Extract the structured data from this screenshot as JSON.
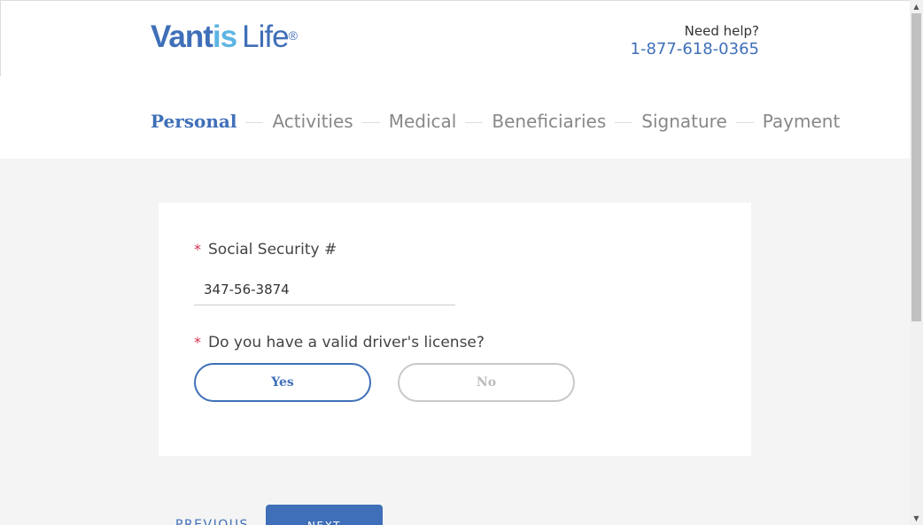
{
  "brand": {
    "logo_part1": "Vant",
    "logo_part2": "is",
    "logo_part3": "Life",
    "logo_reg": "®"
  },
  "help": {
    "label": "Need help?",
    "phone": "1-877-618-0365"
  },
  "steps": [
    {
      "label": "Personal",
      "active": true
    },
    {
      "label": "Activities",
      "active": false
    },
    {
      "label": "Medical",
      "active": false
    },
    {
      "label": "Beneficiaries",
      "active": false
    },
    {
      "label": "Signature",
      "active": false
    },
    {
      "label": "Payment",
      "active": false
    }
  ],
  "form": {
    "required_marker": "*",
    "ssn_label": "Social Security #",
    "ssn_value": "347-56-3874",
    "license_label": "Do you have a valid driver's license?",
    "yes_label": "Yes",
    "no_label": "No",
    "selected": "Yes"
  },
  "nav": {
    "previous_label": "PREVIOUS",
    "next_label": "NEXT"
  },
  "colors": {
    "brand_blue": "#3f6fb8",
    "brand_light_blue": "#5cb4e3",
    "required_red": "#d2334f"
  },
  "icons": {
    "scroll_up": "triangle-up-icon",
    "scroll_down": "triangle-down-icon"
  }
}
